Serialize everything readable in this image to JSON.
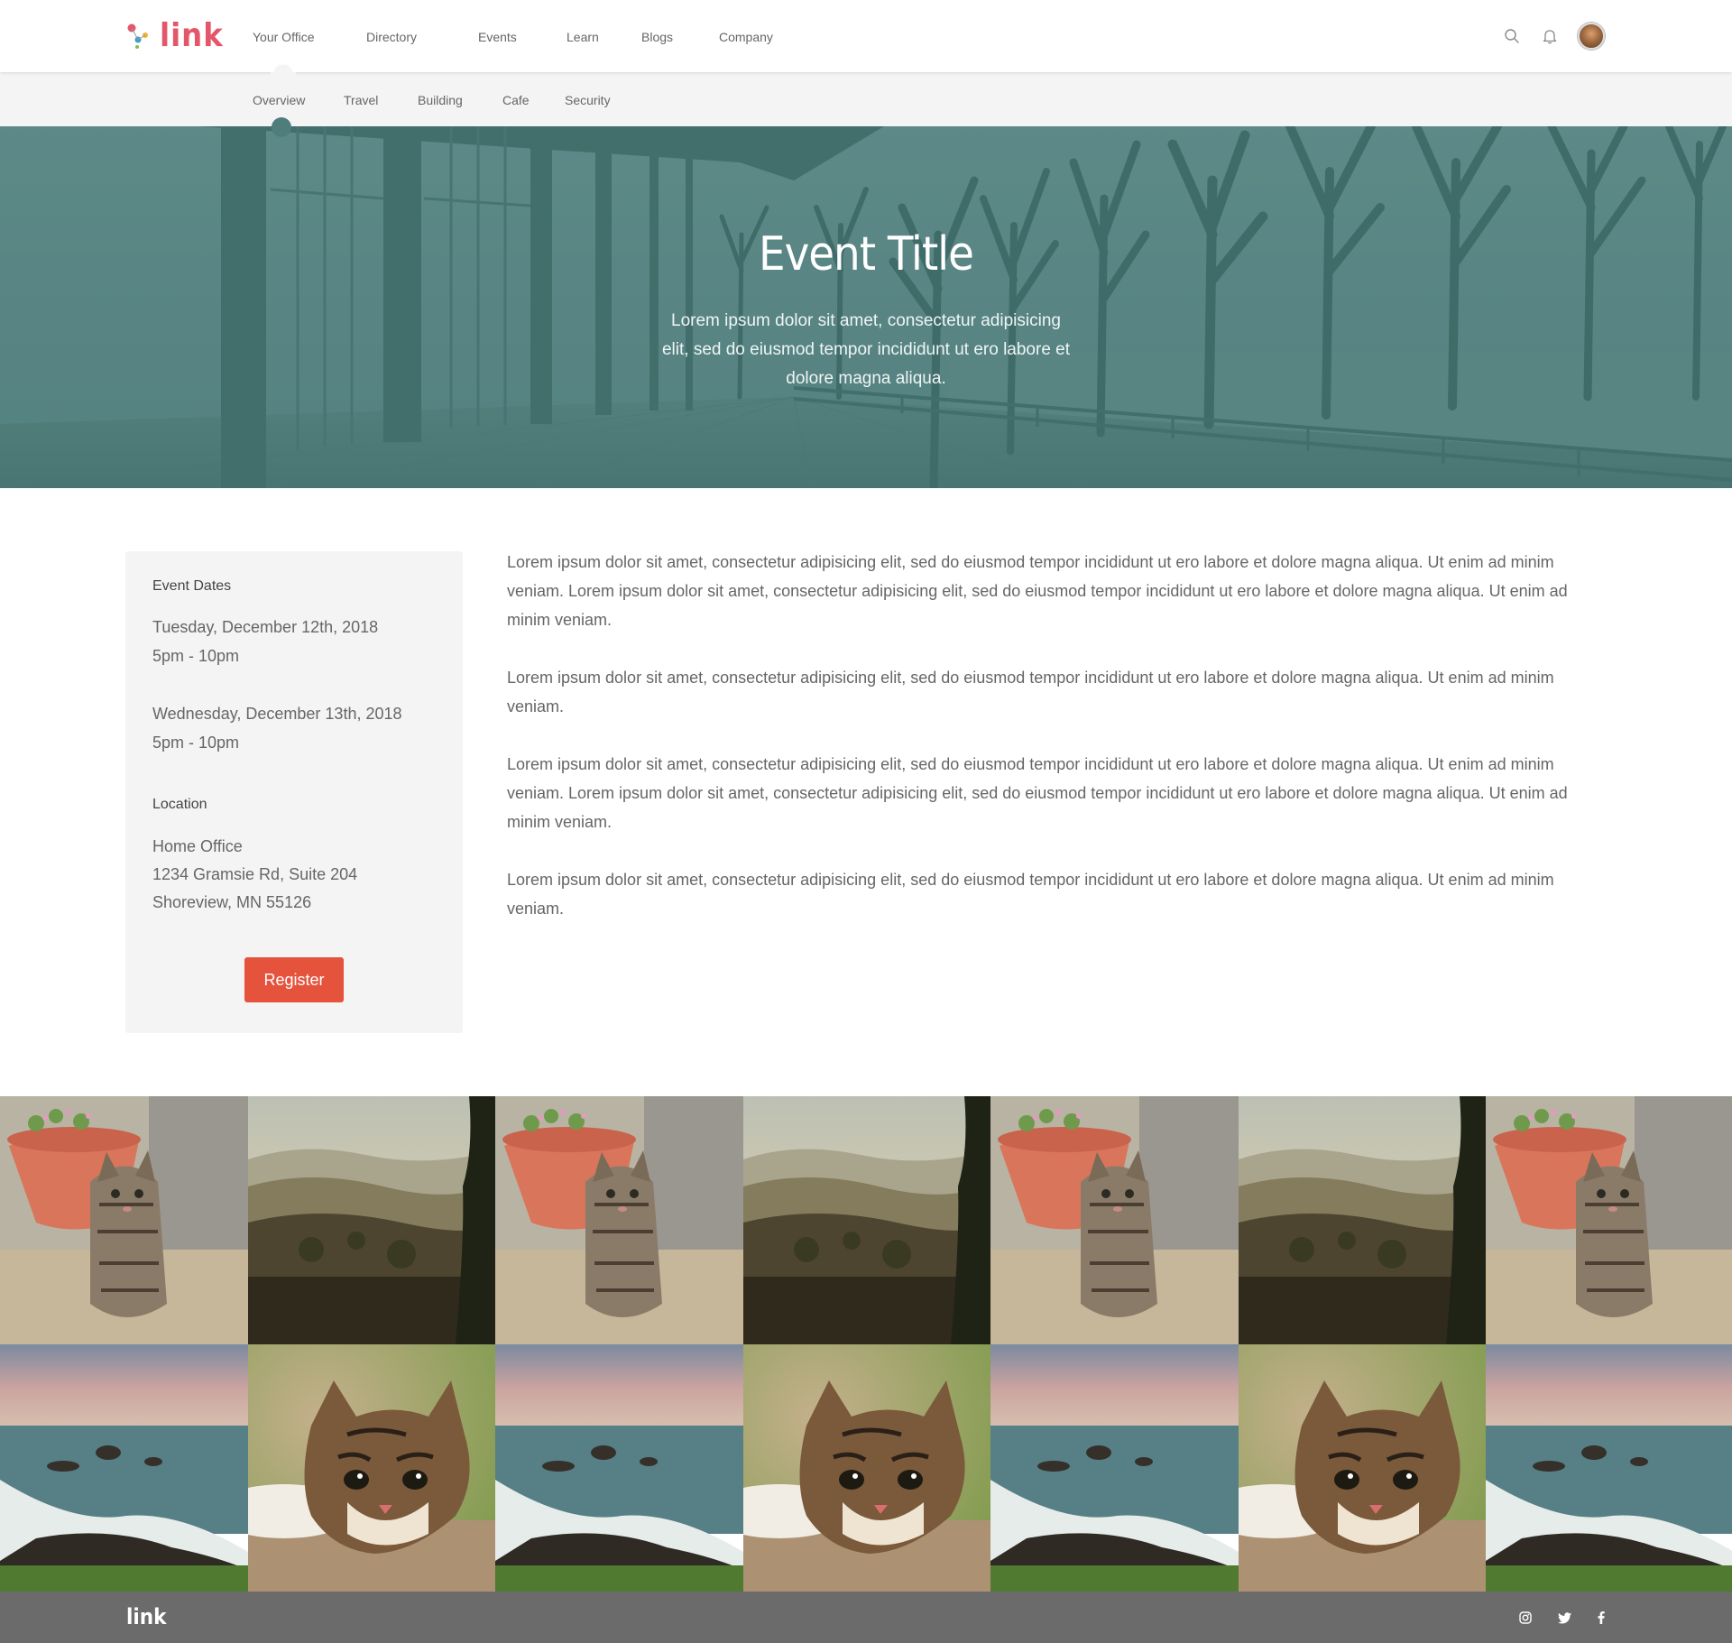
{
  "brand": {
    "name": "link",
    "accent": "#e4576b",
    "button_color": "#e5533d",
    "hero_tint": "#4e7a78"
  },
  "top_nav": {
    "items": [
      "Your Office",
      "Directory",
      "Events",
      "Learn",
      "Blogs",
      "Company"
    ],
    "active": "Your Office",
    "icons": [
      "search-icon",
      "bell-icon",
      "avatar"
    ]
  },
  "sub_nav": {
    "items": [
      "Overview",
      "Travel",
      "Building",
      "Cafe",
      "Security"
    ],
    "active": "Overview"
  },
  "hero": {
    "title": "Event Title",
    "subtitle": "Lorem ipsum dolor sit amet, consectetur adipisicing elit, sed do eiusmod tempor incididunt ut ero labore et dolore magna aliqua."
  },
  "event_card": {
    "dates_label": "Event Dates",
    "dates": [
      {
        "day": "Tuesday, December 12th, 2018",
        "time": "5pm - 10pm"
      },
      {
        "day": "Wednesday, December 13th, 2018",
        "time": "5pm - 10pm"
      }
    ],
    "location_label": "Location",
    "location": [
      "Home Office",
      "1234 Gramsie Rd, Suite 204",
      "Shoreview, MN 55126"
    ],
    "register_label": "Register"
  },
  "article": {
    "paragraphs": [
      "Lorem ipsum dolor sit amet, consectetur adipisicing elit, sed do eiusmod tempor incididunt ut ero labore et dolore magna aliqua. Ut enim ad minim veniam. Lorem ipsum dolor sit amet, consectetur adipisicing elit, sed do eiusmod tempor incididunt ut ero labore et dolore magna aliqua. Ut enim ad minim veniam.",
      "Lorem ipsum dolor sit amet, consectetur adipisicing elit, sed do eiusmod tempor incididunt ut ero labore et dolore magna aliqua. Ut enim ad minim veniam.",
      "Lorem ipsum dolor sit amet, consectetur adipisicing elit, sed do eiusmod tempor incididunt ut ero labore et dolore magna aliqua. Ut enim ad minim veniam. Lorem ipsum dolor sit amet, consectetur adipisicing elit, sed do eiusmod tempor incididunt ut ero labore et dolore magna aliqua. Ut enim ad minim veniam.",
      "Lorem ipsum dolor sit amet, consectetur adipisicing elit, sed do eiusmod tempor incididunt ut ero labore et dolore magna aliqua. Ut enim ad minim veniam."
    ]
  },
  "gallery": {
    "rows": [
      [
        "kitten-flowerpot-photo",
        "hills-landscape-photo",
        "kitten-flowerpot-photo",
        "hills-landscape-photo",
        "kitten-flowerpot-photo",
        "hills-landscape-photo",
        "kitten-flowerpot-photo"
      ],
      [
        "seaside-rocks-photo",
        "kitten-closeup-photo",
        "seaside-rocks-photo",
        "kitten-closeup-photo",
        "seaside-rocks-photo",
        "kitten-closeup-photo",
        "seaside-rocks-photo"
      ]
    ]
  },
  "footer": {
    "logo": "link",
    "social_icons": [
      "instagram-icon",
      "twitter-icon",
      "facebook-icon"
    ]
  }
}
